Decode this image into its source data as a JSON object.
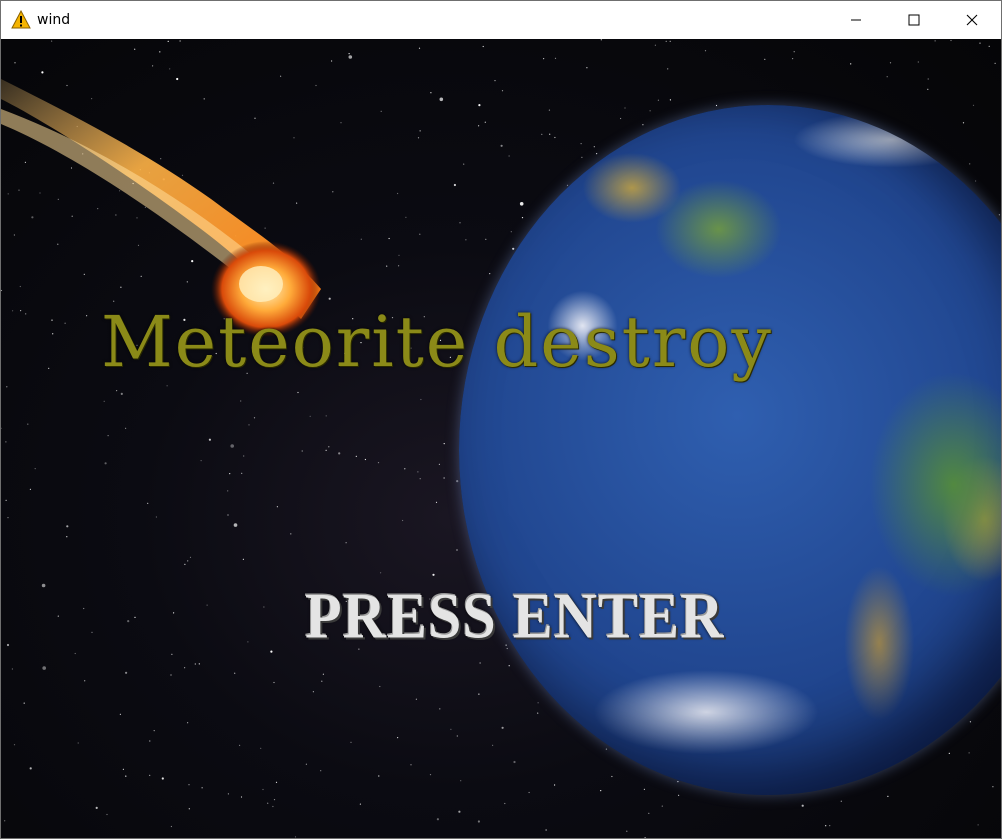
{
  "window": {
    "title": "wind",
    "icon": "warning-icon",
    "controls": [
      "minimize-icon",
      "maximize-icon",
      "close-icon"
    ]
  },
  "game": {
    "title": "Meteorite destroy",
    "prompt": "PRESS ENTER",
    "colors": {
      "title_text": "#8b8a18",
      "prompt_text": "#e4e4e4",
      "space": "#050507",
      "ocean": "#20458e"
    }
  }
}
